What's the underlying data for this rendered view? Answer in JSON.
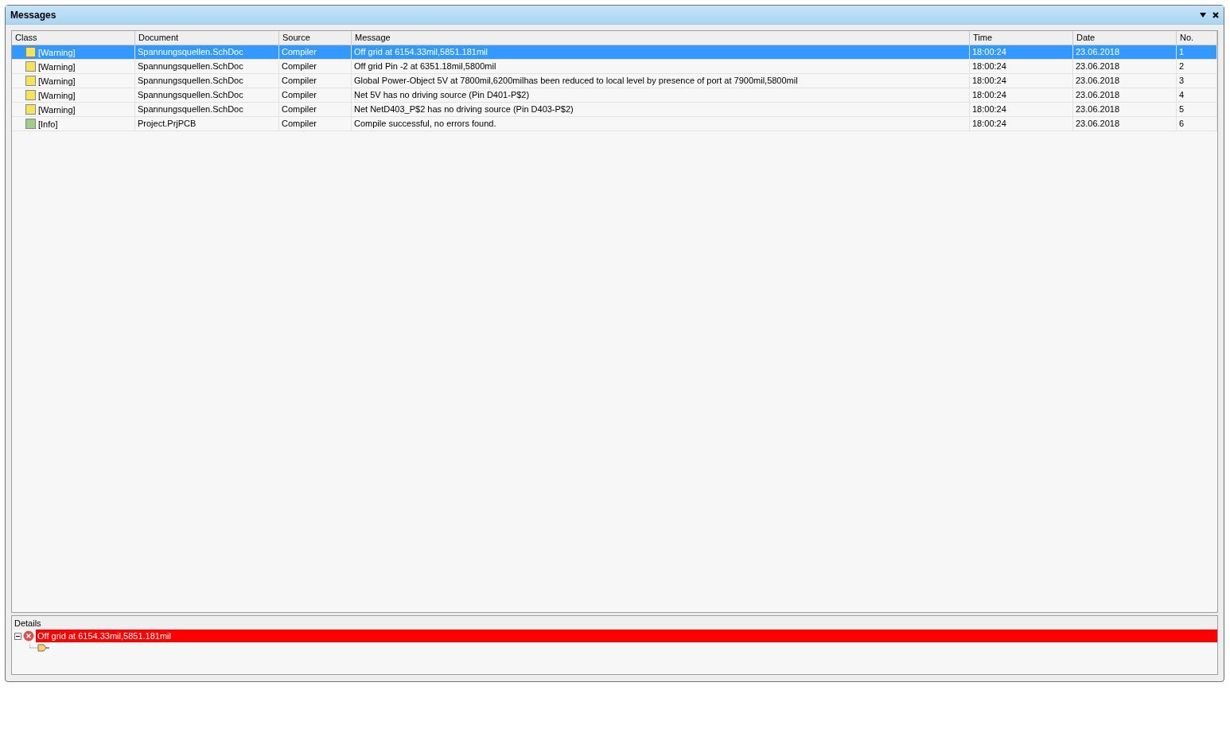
{
  "window": {
    "title": "Messages"
  },
  "table": {
    "columns": [
      "Class",
      "Document",
      "Source",
      "Message",
      "Time",
      "Date",
      "No."
    ],
    "rows": [
      {
        "kind": "warning",
        "selected": true,
        "cells": [
          "[Warning]",
          "Spannungsquellen.SchDoc",
          "Compiler",
          "Off grid  at 6154.33mil,5851.181mil",
          "18:00:24",
          "23.06.2018",
          "1"
        ]
      },
      {
        "kind": "warning",
        "selected": false,
        "cells": [
          "[Warning]",
          "Spannungsquellen.SchDoc",
          "Compiler",
          "Off grid Pin -2 at 6351.18mil,5800mil",
          "18:00:24",
          "23.06.2018",
          "2"
        ]
      },
      {
        "kind": "warning",
        "selected": false,
        "cells": [
          "[Warning]",
          "Spannungsquellen.SchDoc",
          "Compiler",
          "Global Power-Object 5V at 7800mil,6200milhas been reduced to local level by presence of port at 7900mil,5800mil",
          "18:00:24",
          "23.06.2018",
          "3"
        ]
      },
      {
        "kind": "warning",
        "selected": false,
        "cells": [
          "[Warning]",
          "Spannungsquellen.SchDoc",
          "Compiler",
          "Net 5V has no driving source (Pin D401-P$2)",
          "18:00:24",
          "23.06.2018",
          "4"
        ]
      },
      {
        "kind": "warning",
        "selected": false,
        "cells": [
          "[Warning]",
          "Spannungsquellen.SchDoc",
          "Compiler",
          "Net NetD403_P$2 has no driving source (Pin D403-P$2)",
          "18:00:24",
          "23.06.2018",
          "5"
        ]
      },
      {
        "kind": "info",
        "selected": false,
        "cells": [
          "[Info]",
          "Project.PrjPCB",
          "Compiler",
          "Compile successful, no errors found.",
          "18:00:24",
          "23.06.2018",
          "6"
        ]
      }
    ]
  },
  "details": {
    "title": "Details",
    "items": [
      {
        "text": "Off grid  at 6154.33mil,5851.181mil",
        "expanded": true
      }
    ]
  }
}
